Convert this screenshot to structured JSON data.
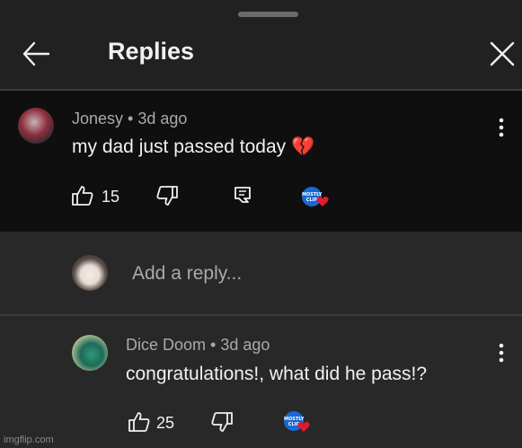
{
  "header": {
    "title": "Replies"
  },
  "main_comment": {
    "author_line": "Jonesy • 3d ago",
    "text": "my dad just passed today 💔",
    "like_count": "15"
  },
  "reply_input": {
    "placeholder": "Add a reply..."
  },
  "reply": {
    "author_line": "Dice Doom • 3d ago",
    "text": "congratulations!, what did he pass!?",
    "like_count": "25"
  },
  "creator_badge": {
    "label": "MOSTLY CLIP"
  },
  "watermark": "imgflip.com",
  "colors": {
    "background": "#282828",
    "header": "#212121",
    "highlighted_comment": "#0f0f0f",
    "heart": "#e21b2c",
    "badge": "#1769d6"
  }
}
